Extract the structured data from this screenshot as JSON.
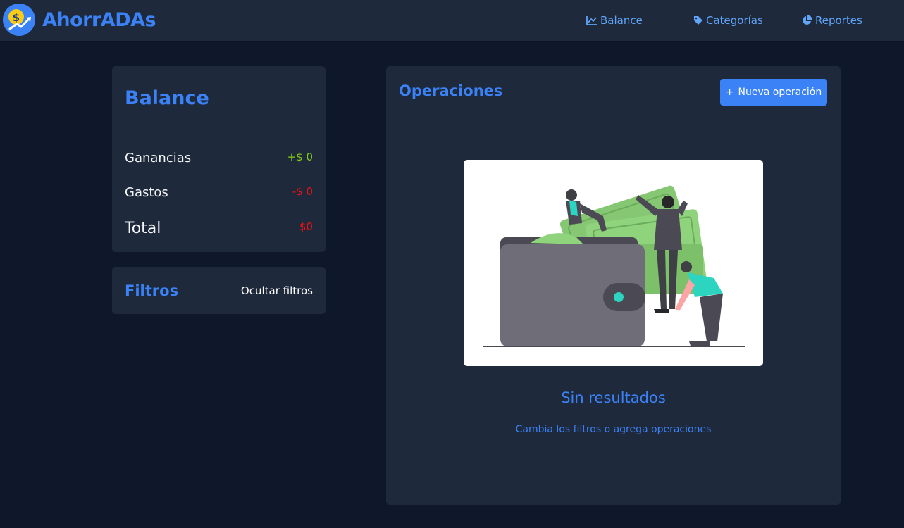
{
  "brand": {
    "name": "AhorrADAs",
    "logo_icon": "money-growth-icon"
  },
  "nav": [
    {
      "label": "Balance",
      "icon": "chart-line-icon"
    },
    {
      "label": "Categorías",
      "icon": "tag-icon"
    },
    {
      "label": "Reportes",
      "icon": "pie-chart-icon"
    }
  ],
  "balance": {
    "title": "Balance",
    "rows": [
      {
        "label": "Ganancias",
        "value": "+$ 0"
      },
      {
        "label": "Gastos",
        "value": "-$ 0"
      },
      {
        "label": "Total",
        "value": "$0"
      }
    ]
  },
  "filters": {
    "title": "Filtros",
    "toggle_label": "Ocultar filtros"
  },
  "operations": {
    "title": "Operaciones",
    "new_button_icon": "+",
    "new_button_label": "Nueva operación",
    "empty_title": "Sin resultados",
    "empty_subtitle": "Cambia los filtros o agrega operaciones"
  },
  "colors": {
    "background": "#0f172a",
    "card": "#1e293b",
    "accent": "#3b82f6",
    "positive": "#84cc16",
    "negative": "#ef1111"
  }
}
